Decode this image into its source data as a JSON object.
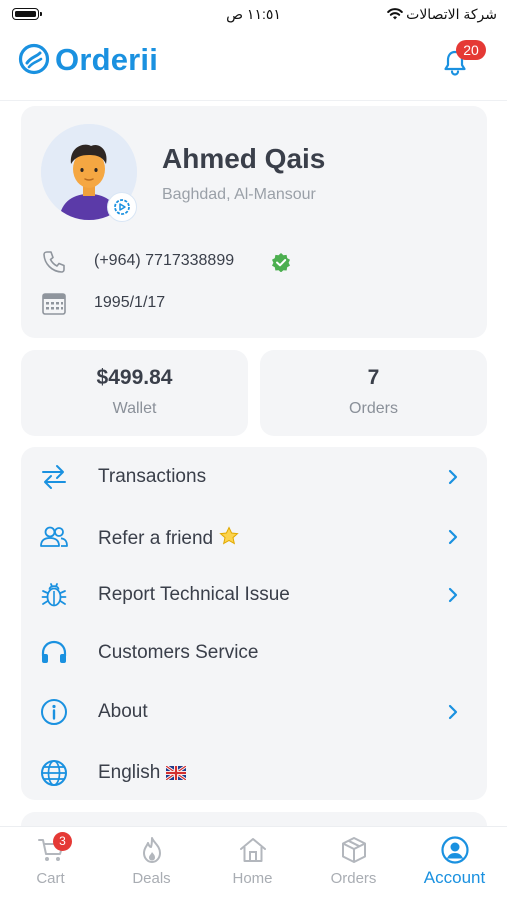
{
  "status_bar": {
    "time": "١١:٥١ ص",
    "carrier": "شركة الاتصالات"
  },
  "header": {
    "app_name": "Orderii",
    "notification_count": "20",
    "brand_color": "#1a91e0"
  },
  "profile": {
    "name": "Ahmed Qais",
    "location": "Baghdad, Al-Mansour",
    "phone": "(+964) 7717338899",
    "birth_date": "1995/1/17"
  },
  "stats": {
    "wallet_value": "$499.84",
    "wallet_label": "Wallet",
    "orders_value": "7",
    "orders_label": "Orders"
  },
  "menu": {
    "items": [
      {
        "label": "Transactions",
        "icon": "transfer-arrows-icon",
        "has_chevron": true
      },
      {
        "label": "Refer a friend",
        "icon": "users-icon",
        "emoji": "⭐",
        "has_chevron": true
      },
      {
        "label": "Report Technical Issue",
        "icon": "bug-icon",
        "has_chevron": true
      },
      {
        "label": "Customers Service",
        "icon": "headphones-icon",
        "has_chevron": false
      },
      {
        "label": "About",
        "icon": "info-icon",
        "has_chevron": true
      },
      {
        "label": "English",
        "icon": "globe-icon",
        "emoji": "🇬🇧",
        "has_chevron": false
      }
    ]
  },
  "tabs": [
    {
      "label": "Cart",
      "icon": "cart-icon",
      "badge": "3",
      "active": false
    },
    {
      "label": "Deals",
      "icon": "flame-icon",
      "active": false
    },
    {
      "label": "Home",
      "icon": "home-icon",
      "active": false
    },
    {
      "label": "Orders",
      "icon": "box-icon",
      "active": false
    },
    {
      "label": "Account",
      "icon": "account-icon",
      "active": true
    }
  ],
  "colors": {
    "accent": "#1a91e0",
    "badge": "#e53935",
    "verified": "#4caf50",
    "card_bg": "#f4f5f7"
  }
}
